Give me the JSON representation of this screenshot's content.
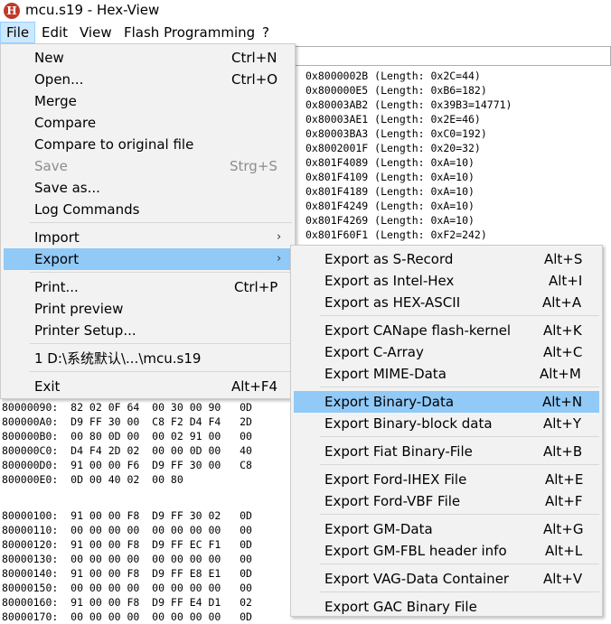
{
  "window": {
    "title": "mcu.s19 - Hex-View",
    "icon": "app-logo-icon"
  },
  "menubar": [
    "File",
    "Edit",
    "View",
    "Flash Programming",
    "?"
  ],
  "ranges": [
    "0x8000002B (Length: 0x2C=44)",
    "0x800000E5 (Length: 0xB6=182)",
    "0x80003AB2 (Length: 0x39B3=14771)",
    "0x80003AE1 (Length: 0x2E=46)",
    "0x80003BA3 (Length: 0xC0=192)",
    "0x8002001F (Length: 0x20=32)",
    "0x801F4089 (Length: 0xA=10)",
    "0x801F4109 (Length: 0xA=10)",
    "0x801F4189 (Length: 0xA=10)",
    "0x801F4249 (Length: 0xA=10)",
    "0x801F4269 (Length: 0xA=10)",
    "0x801F60F1 (Length: 0xF2=242)"
  ],
  "hex_rows": [
    "80000090:  82 02 0F 64  00 30 00 90   0D",
    "800000A0:  D9 FF 30 00  C8 F2 D4 F4   2D",
    "800000B0:  00 80 0D 00  00 02 91 00   00",
    "800000C0:  D4 F4 2D 02  00 00 0D 00   40",
    "800000D0:  91 00 00 F6  D9 FF 30 00   C8",
    "800000E0:  0D 00 40 02  00 80",
    "80000100:  91 00 00 F8  D9 FF 30 02   0D",
    "80000110:  00 00 00 00  00 00 00 00   00",
    "80000120:  91 00 00 F8  D9 FF EC F1   0D",
    "80000130:  00 00 00 00  00 00 00 00   00",
    "80000140:  91 00 00 F8  D9 FF E8 E1   0D",
    "80000150:  00 00 00 00  00 00 00 00   00",
    "80000160:  91 00 00 F8  D9 FF E4 D1   02",
    "80000170:  00 00 00 00  00 00 00 00   0D"
  ],
  "file_menu": [
    {
      "label": "New",
      "shortcut": "Ctrl+N"
    },
    {
      "label": "Open...",
      "shortcut": "Ctrl+O"
    },
    {
      "label": "Merge",
      "shortcut": ""
    },
    {
      "label": "Compare",
      "shortcut": ""
    },
    {
      "label": "Compare to original file",
      "shortcut": ""
    },
    {
      "label": "Save",
      "shortcut": "Strg+S",
      "disabled": true
    },
    {
      "label": "Save as...",
      "shortcut": ""
    },
    {
      "label": "Log Commands",
      "shortcut": ""
    },
    {
      "label": "Import",
      "submenu": true
    },
    {
      "label": "Export",
      "submenu": true,
      "highlighted": true
    },
    {
      "label": "Print...",
      "shortcut": "Ctrl+P"
    },
    {
      "label": "Print preview",
      "shortcut": ""
    },
    {
      "label": "Printer Setup...",
      "shortcut": ""
    },
    {
      "label": "1 D:\\系统默认\\...\\mcu.s19",
      "shortcut": ""
    },
    {
      "label": "Exit",
      "shortcut": "Alt+F4"
    }
  ],
  "export_menu": [
    {
      "label": "Export as S-Record",
      "shortcut": "Alt+S"
    },
    {
      "label": "Export as Intel-Hex",
      "shortcut": "Alt+I"
    },
    {
      "label": "Export as HEX-ASCII",
      "shortcut": "Alt+A"
    },
    {
      "label": "Export CANape flash-kernel",
      "shortcut": "Alt+K"
    },
    {
      "label": "Export C-Array",
      "shortcut": "Alt+C"
    },
    {
      "label": "Export MIME-Data",
      "shortcut": "Alt+M"
    },
    {
      "label": "Export Binary-Data",
      "shortcut": "Alt+N",
      "highlighted": true
    },
    {
      "label": "Export Binary-block data",
      "shortcut": "Alt+Y"
    },
    {
      "label": "Export Fiat Binary-File",
      "shortcut": "Alt+B"
    },
    {
      "label": "Export Ford-IHEX File",
      "shortcut": "Alt+E"
    },
    {
      "label": "Export Ford-VBF File",
      "shortcut": "Alt+F"
    },
    {
      "label": "Export GM-Data",
      "shortcut": "Alt+G"
    },
    {
      "label": "Export GM-FBL header info",
      "shortcut": "Alt+L"
    },
    {
      "label": "Export VAG-Data Container",
      "shortcut": "Alt+V"
    },
    {
      "label": "Export GAC Binary File",
      "shortcut": ""
    }
  ],
  "colors": {
    "highlight": "#91c9f7",
    "menu_bg": "#f2f2f2",
    "menubar_active": "#cce8ff",
    "app_icon": "#c0392b"
  }
}
